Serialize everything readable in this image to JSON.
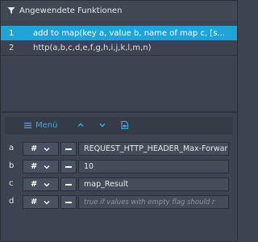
{
  "header": {
    "title": "Angewendete Funktionen",
    "icon": "filter-icon"
  },
  "functions": [
    {
      "num": "1",
      "text": "add to map(key a, value b, name of map c, [s...",
      "selected": true
    },
    {
      "num": "2",
      "text": "http(a,b,c,d,e,f,g,h,i,j,k,l,m,n)",
      "selected": false
    }
  ],
  "toolbar": {
    "menu_label": "Menü",
    "menu_icon": "menu-icon",
    "up_icon": "chevron-up-icon",
    "down_icon": "chevron-down-icon",
    "file_icon": "document-icon"
  },
  "params": [
    {
      "label": "a",
      "type": "#",
      "value": "REQUEST_HTTP_HEADER_Max-Forwar",
      "placeholder": false
    },
    {
      "label": "b",
      "type": "#",
      "value": "10",
      "placeholder": false
    },
    {
      "label": "c",
      "type": "#",
      "value": "map_Result",
      "placeholder": false
    },
    {
      "label": "d",
      "type": "#",
      "value": "true if values with empty flag should r",
      "placeholder": true
    }
  ],
  "colors": {
    "accent": "#1fa3d8",
    "background": "#3b4450",
    "icon_blue": "#3fa9e0"
  }
}
